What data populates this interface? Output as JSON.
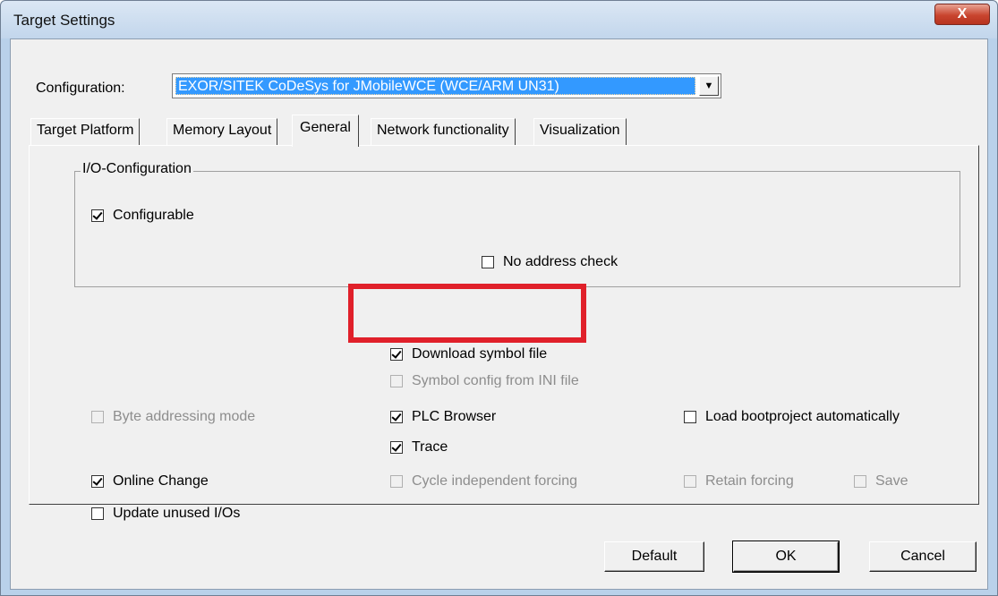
{
  "window": {
    "title": "Target Settings",
    "close_label": "X"
  },
  "configuration": {
    "label": "Configuration:",
    "value": "EXOR/SITEK CoDeSys for JMobileWCE (WCE/ARM UN31)"
  },
  "tabs": [
    {
      "label": "Target Platform",
      "active": false
    },
    {
      "label": "Memory Layout",
      "active": false
    },
    {
      "label": "General",
      "active": true
    },
    {
      "label": "Network functionality",
      "active": false
    },
    {
      "label": "Visualization",
      "active": false
    }
  ],
  "io_group": {
    "title": "I/O-Configuration",
    "configurable": {
      "label": "Configurable",
      "checked": true
    },
    "no_address_check": {
      "label": "No address check",
      "checked": false
    }
  },
  "options": {
    "download_symbol_file": {
      "label": "Download symbol file",
      "checked": true
    },
    "symbol_config_ini": {
      "label": "Symbol config from INI file",
      "checked": false,
      "disabled": true
    },
    "byte_addressing_mode": {
      "label": "Byte addressing mode",
      "checked": false,
      "disabled": true
    },
    "plc_browser": {
      "label": "PLC Browser",
      "checked": true
    },
    "load_bootproject": {
      "label": "Load bootproject automatically",
      "checked": false
    },
    "trace": {
      "label": "Trace",
      "checked": true
    },
    "online_change": {
      "label": "Online Change",
      "checked": true
    },
    "cycle_independent_forcing": {
      "label": "Cycle independent forcing",
      "checked": false,
      "disabled": true
    },
    "retain_forcing": {
      "label": "Retain forcing",
      "checked": false,
      "disabled": true
    },
    "save": {
      "label": "Save",
      "checked": false,
      "disabled": true
    },
    "update_unused_ios": {
      "label": "Update unused I/Os",
      "checked": false
    }
  },
  "buttons": {
    "default": "Default",
    "ok": "OK",
    "cancel": "Cancel"
  },
  "colors": {
    "selection": "#3399ff",
    "highlight_box": "#e0202a",
    "dialog_bg": "#f0f0f0"
  }
}
